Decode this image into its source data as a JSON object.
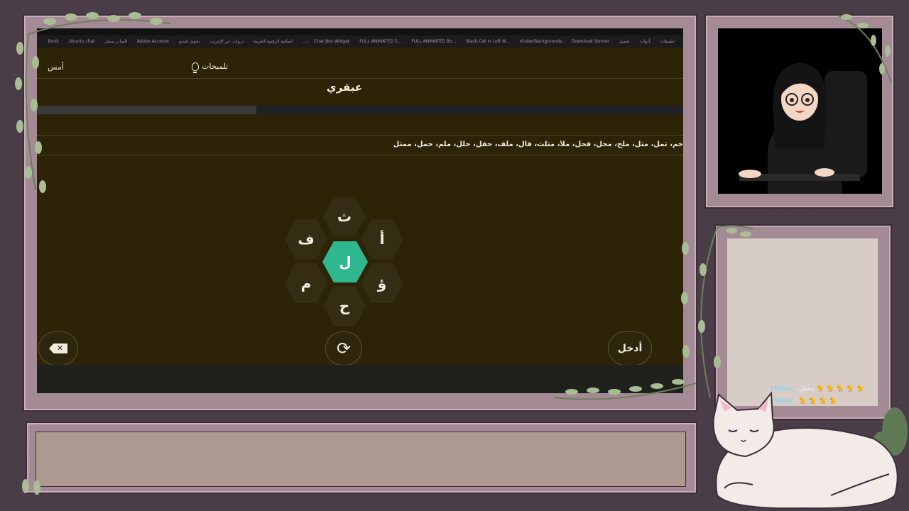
{
  "browser": {
    "bookmarks": [
      "تطبيقات",
      "أدوات",
      "تحميل",
      "Chat Box Widget",
      "FULL ANIMATED S...",
      "FULL ANIMATED Bo...",
      "Black Cat in Loft W...",
      "VtuberBackgrounds...",
      "Download Sonnet -...",
      "المكتبة الرقمية العربية",
      "دروات عبر الإنترنت",
      "تحويل فيديو",
      "Adobe Account",
      "الصادر سجل",
      "Book",
      "Ubuntu chat"
    ]
  },
  "game": {
    "yesterday_label": "أمس",
    "hints_label": "تلميحات",
    "rank": "عبقري",
    "progress": 0.34,
    "found_words": "حم، ثمل، مثل، ملح، محل، فحل، ملأ، مثلث، فأل، ملف، حفل، حلل، ملم، حمل، ممثل",
    "letters": {
      "center": "ل",
      "top": "ث",
      "upper_right": "أ",
      "lower_right": "ؤ",
      "bottom": "ح",
      "lower_left": "م",
      "upper_left": "ف"
    },
    "enter_label": "أدخل",
    "shuffle_icon": "refresh-icon",
    "delete_icon": "backspace-icon"
  },
  "chat": {
    "messages": [
      {
        "user": "1MiKey_",
        "text": "محفل 🐈 🐈 🐈 🐈 🐈"
      },
      {
        "user": "1MiKey_",
        "text": "🐈 🐈 🐈 🐈"
      }
    ]
  },
  "colors": {
    "center_hex": "#2fb88e",
    "game_bg": "#2d2408",
    "frame": "#a48a95"
  }
}
